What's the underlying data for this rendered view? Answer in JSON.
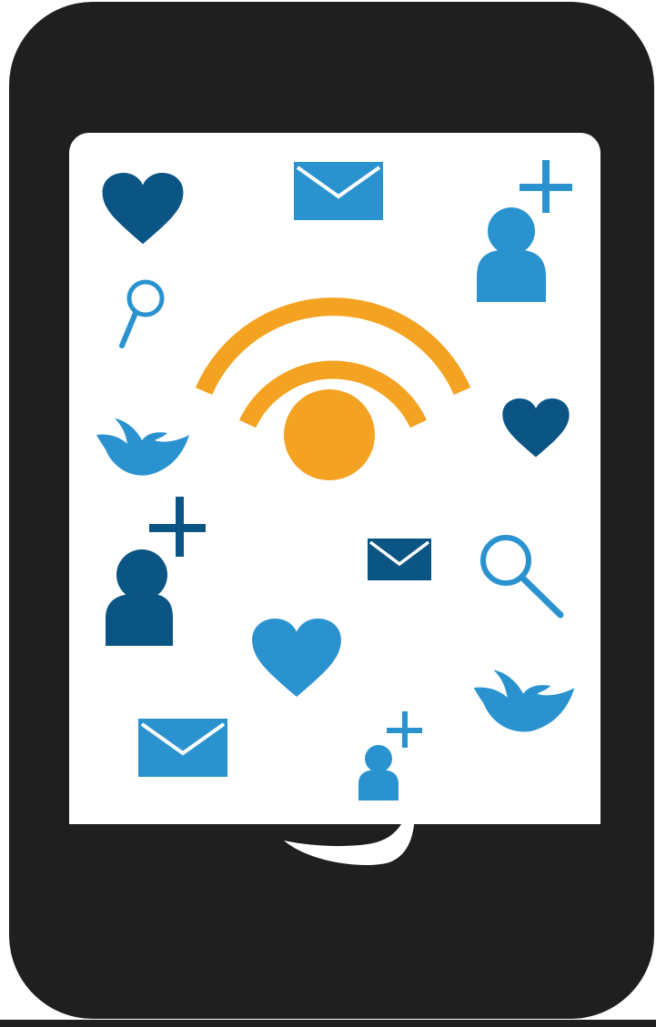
{
  "colors": {
    "phone_body": "#1f1f1f",
    "screen": "#ffffff",
    "dark_blue": "#0b5584",
    "light_blue": "#2a93cf",
    "orange": "#f3a321"
  },
  "icons": [
    "heart-icon",
    "envelope-icon",
    "add-user-icon",
    "search-icon",
    "wifi-signal-icon",
    "bird-icon"
  ]
}
